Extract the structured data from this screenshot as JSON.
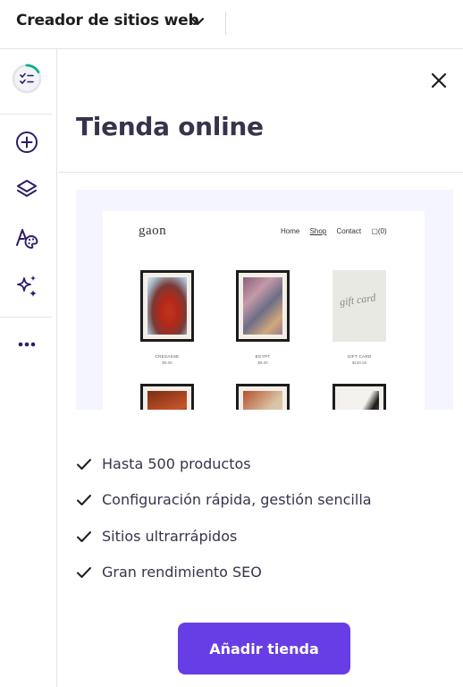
{
  "header": {
    "title": "Creador de sitios web",
    "chevron_icon": "chevron-down-icon"
  },
  "rail": {
    "items": [
      {
        "icon": "checklist-progress-icon"
      },
      {
        "icon": "add-circle-icon"
      },
      {
        "icon": "layers-icon"
      },
      {
        "icon": "text-palette-icon"
      },
      {
        "icon": "sparkles-icon"
      },
      {
        "icon": "more-horizontal-icon"
      }
    ],
    "progress_color": "#00b090"
  },
  "panel": {
    "title": "Tienda online",
    "close_icon": "close-icon",
    "preview": {
      "logo": "gaon",
      "nav": [
        "Home",
        "Shop",
        "Contact",
        "(0)"
      ],
      "products": [
        {
          "name": "CRESASSE",
          "price": "$9.00"
        },
        {
          "name": "EGYPT",
          "price": "$9.00"
        },
        {
          "name": "GIFT CARD",
          "price": "$100.00"
        }
      ],
      "gift_card_text": "gift card"
    },
    "features": [
      "Hasta 500 productos",
      "Configuración rápida, gestión sencilla",
      "Sitios ultrarrápidos",
      "Gran rendimiento SEO"
    ],
    "cta_label": "Añadir tienda"
  },
  "colors": {
    "accent": "#673de6",
    "text_dark": "#36344d",
    "preview_bg": "#f4f5ff"
  }
}
